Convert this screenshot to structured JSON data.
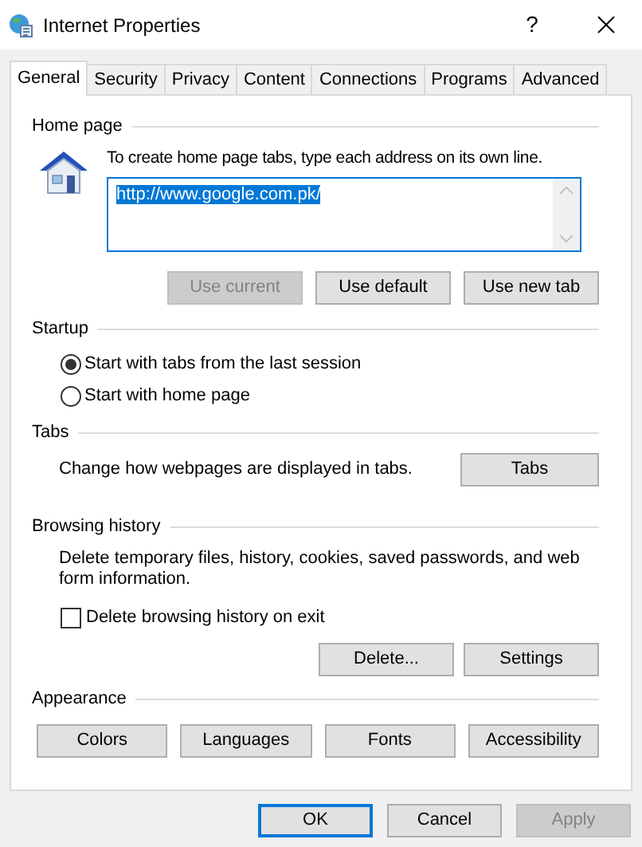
{
  "window": {
    "title": "Internet Properties",
    "help": "?"
  },
  "tabs": [
    {
      "label": "General",
      "selected": true
    },
    {
      "label": "Security",
      "selected": false
    },
    {
      "label": "Privacy",
      "selected": false
    },
    {
      "label": "Content",
      "selected": false
    },
    {
      "label": "Connections",
      "selected": false
    },
    {
      "label": "Programs",
      "selected": false
    },
    {
      "label": "Advanced",
      "selected": false
    }
  ],
  "home_page": {
    "heading": "Home page",
    "instruction": "To create home page tabs, type each address on its own line.",
    "addresses": "http://www.google.com.pk/",
    "buttons": [
      {
        "label": "Use current",
        "disabled": true
      },
      {
        "label": "Use default",
        "disabled": false
      },
      {
        "label": "Use new tab",
        "disabled": false
      }
    ]
  },
  "startup": {
    "heading": "Startup",
    "options": [
      {
        "label": "Start with tabs from the last session",
        "selected": true
      },
      {
        "label": "Start with home page",
        "selected": false
      }
    ]
  },
  "tabs_section": {
    "heading": "Tabs",
    "description": "Change how webpages are displayed in tabs.",
    "button": "Tabs"
  },
  "browsing_history": {
    "heading": "Browsing history",
    "description": "Delete temporary files, history, cookies, saved passwords, and web form information.",
    "checkbox": {
      "label": "Delete browsing history on exit",
      "checked": false
    },
    "buttons": [
      {
        "label": "Delete...",
        "disabled": false
      },
      {
        "label": "Settings",
        "disabled": false
      }
    ]
  },
  "appearance": {
    "heading": "Appearance",
    "buttons": [
      {
        "label": "Colors",
        "disabled": false
      },
      {
        "label": "Languages",
        "disabled": false
      },
      {
        "label": "Fonts",
        "disabled": false
      },
      {
        "label": "Accessibility",
        "disabled": false
      }
    ]
  },
  "dialog_buttons": [
    {
      "label": "OK",
      "focused": true,
      "disabled": false
    },
    {
      "label": "Cancel",
      "focused": false,
      "disabled": false
    },
    {
      "label": "Apply",
      "focused": false,
      "disabled": true
    }
  ]
}
